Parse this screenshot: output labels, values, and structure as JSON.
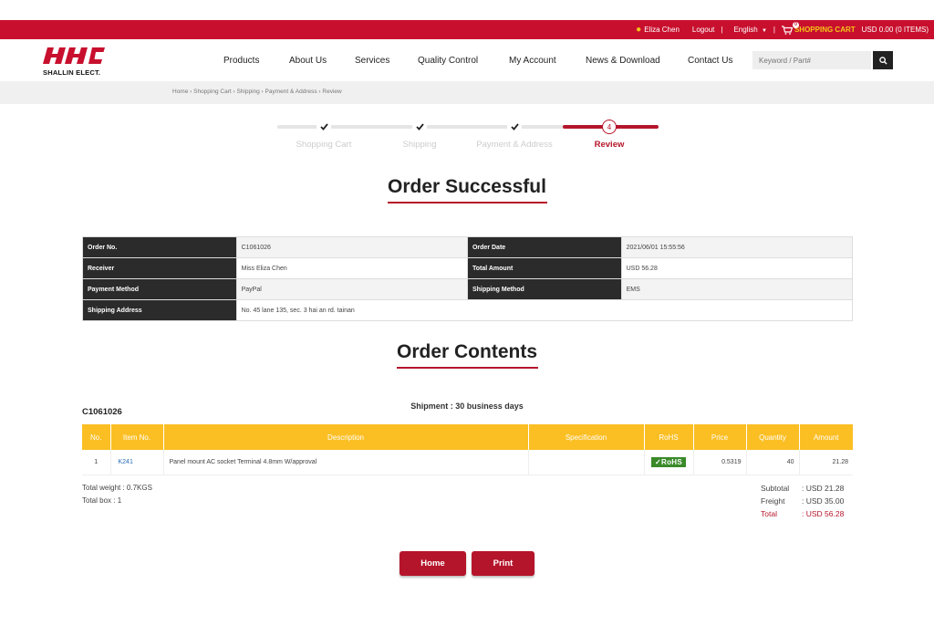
{
  "topbar": {
    "user_name": "Eliza Chen",
    "logout": "Logout",
    "language": "English",
    "cart_count": "0",
    "cart_label": "SHOPPING CART",
    "cart_summary": "USD 0.00 (0 ITEMS)"
  },
  "brand": {
    "logo_text": "SHALLIN ELECT.",
    "color": "#c8102e"
  },
  "nav": {
    "items": [
      "Products",
      "About Us",
      "Services",
      "Quality Control",
      "My Account",
      "News & Download",
      "Contact Us"
    ]
  },
  "search": {
    "placeholder": "Keyword / Part#"
  },
  "breadcrumb": "Home  ›  Shopping Cart  ›  Shipping  ›  Payment & Address  ›  Review",
  "steps": [
    {
      "label": "Shopping Cart",
      "state": "done"
    },
    {
      "label": "Shipping",
      "state": "done"
    },
    {
      "label": "Payment & Address",
      "state": "done"
    },
    {
      "label": "Review",
      "state": "active",
      "number": "4"
    }
  ],
  "titles": {
    "order_successful": "Order Successful",
    "order_contents": "Order Contents"
  },
  "order_info": {
    "order_no_label": "Order No.",
    "order_no": "C1061026",
    "order_date_label": "Order Date",
    "order_date": "2021/06/01 15:55:56",
    "receiver_label": "Receiver",
    "receiver": "Miss Eliza Chen",
    "total_amount_label": "Total Amount",
    "total_amount": "USD 56.28",
    "payment_method_label": "Payment Method",
    "payment_method": "PayPal",
    "shipping_method_label": "Shipping Method",
    "shipping_method": "EMS",
    "shipping_address_label": "Shipping Address",
    "shipping_address": "No. 45 lane 135, sec. 3 hai an rd. tainan"
  },
  "contents": {
    "order_id": "C1061026",
    "shipment": "Shipment : 30 business days",
    "columns": [
      "No.",
      "Item No.",
      "Description",
      "Specification",
      "RoHS",
      "Price",
      "Quantity",
      "Amount"
    ],
    "rows": [
      {
        "no": "1",
        "item_no": "K241",
        "description": "Panel mount AC socket Terminal 4.8mm W/approval",
        "specification": "",
        "rohs": "RoHS",
        "price": "0.5319",
        "quantity": "40",
        "amount": "21.28"
      }
    ],
    "total_weight": "Total weight : 0.7KGS",
    "total_box": "Total box : 1"
  },
  "totals": {
    "subtotal_label": "Subtotal",
    "subtotal": ": USD 21.28",
    "freight_label": "Freight",
    "freight": ": USD 35.00",
    "total_label": "Total",
    "total": ": USD 56.28"
  },
  "buttons": {
    "home": "Home",
    "print": "Print"
  }
}
